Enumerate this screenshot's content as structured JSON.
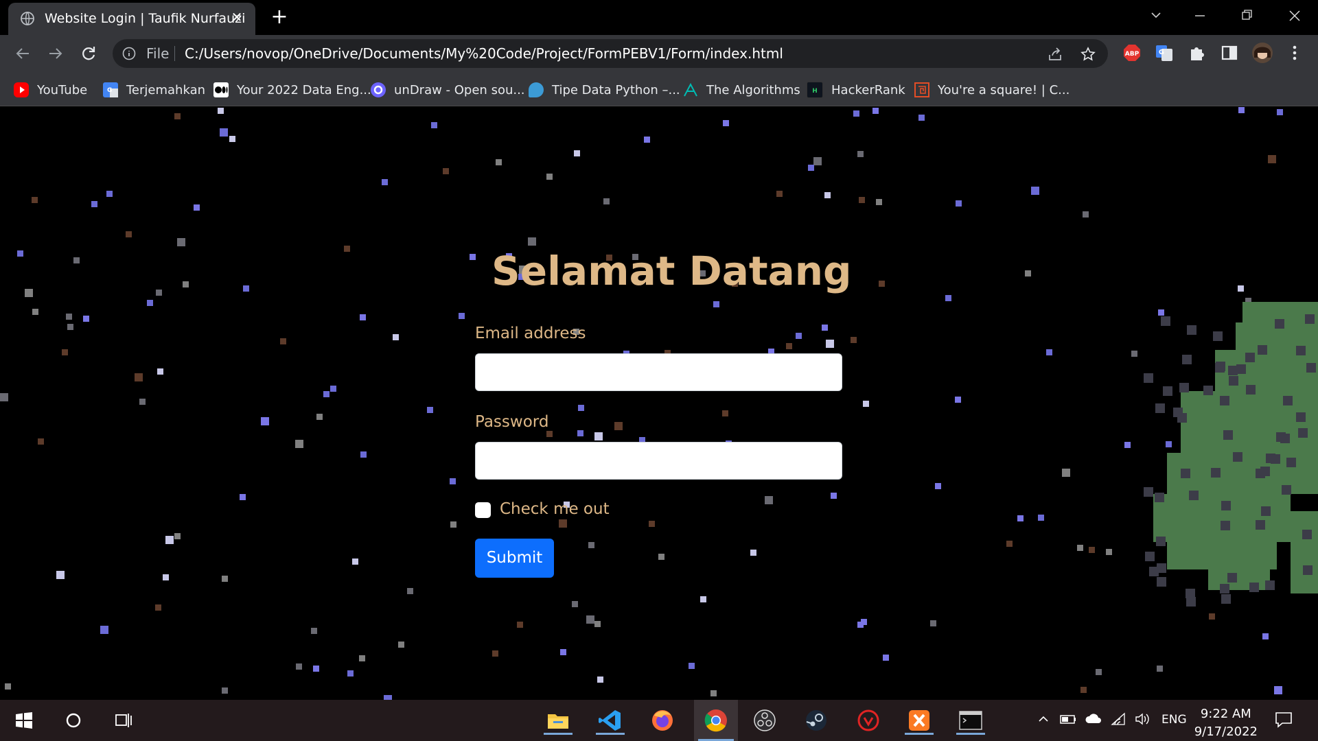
{
  "browser": {
    "tab_title": "Website Login | Taufik Nurfauzi",
    "omnibox": {
      "scheme_label": "File",
      "url": "C:/Users/novop/OneDrive/Documents/My%20Code/Project/FormPEBV1/Form/index.html"
    },
    "extensions": [
      "adblock-plus-icon",
      "google-translate-icon",
      "extensions-puzzle-icon",
      "side-panel-icon",
      "profile-avatar"
    ],
    "bookmarks": [
      {
        "label": "YouTube",
        "icon": "youtube-icon",
        "color": "#ff0000"
      },
      {
        "label": "Terjemahkan",
        "icon": "google-translate-icon",
        "color": "#4285f4"
      },
      {
        "label": "Your 2022 Data Eng...",
        "icon": "medium-icon",
        "color": "#ffffff"
      },
      {
        "label": "unDraw - Open sou...",
        "icon": "undraw-icon",
        "color": "#6c63ff"
      },
      {
        "label": "Tipe Data Python –...",
        "icon": "python-blog-icon",
        "color": "#3c9bd6"
      },
      {
        "label": "The Algorithms",
        "icon": "algorithms-icon",
        "color": "#00bcb4"
      },
      {
        "label": "HackerRank",
        "icon": "hackerrank-icon",
        "color": "#2ec866"
      },
      {
        "label": "You're a square! | C...",
        "icon": "codepen-spiral-icon",
        "color": "#e44d26"
      }
    ]
  },
  "page": {
    "heading": "Selamat Datang",
    "email_label": "Email address",
    "email_value": "",
    "password_label": "Password",
    "password_value": "",
    "checkbox_label": "Check me out",
    "checkbox_checked": false,
    "submit_label": "Submit",
    "heading_color": "#deb887",
    "button_color": "#0d6efd"
  },
  "taskbar": {
    "apps": [
      "file-explorer-icon",
      "vscode-icon",
      "firefox-icon",
      "chrome-icon",
      "obs-icon",
      "steam-icon",
      "app-red-icon",
      "xampp-icon",
      "terminal-icon"
    ],
    "language": "ENG",
    "time": "9:22 AM",
    "date": "9/17/2022"
  }
}
